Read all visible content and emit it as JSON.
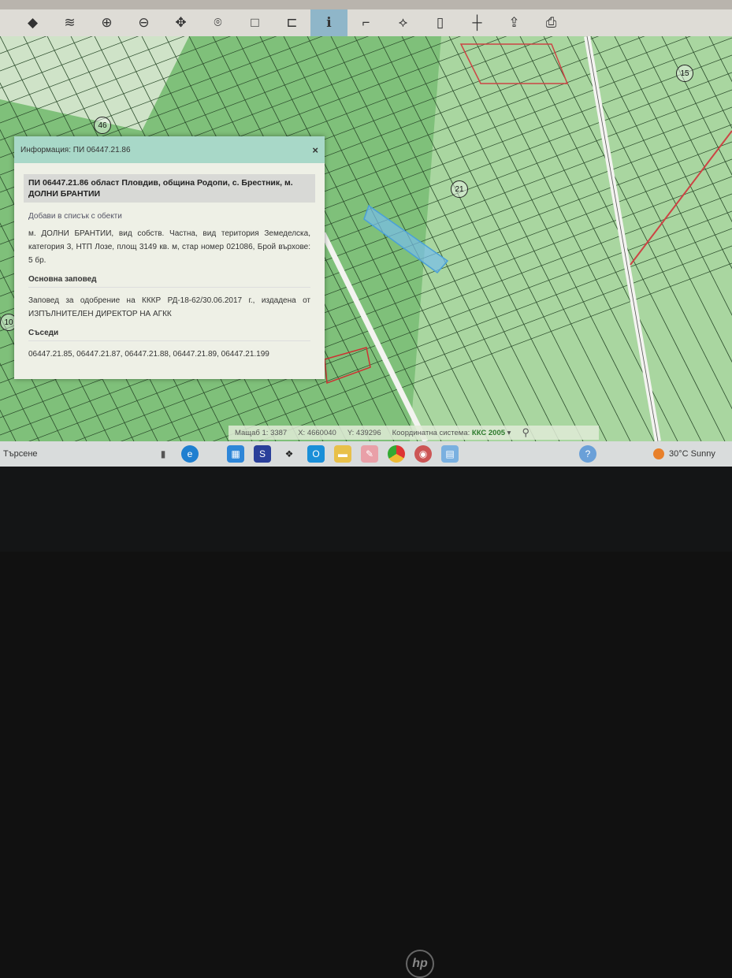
{
  "toolbar": {
    "icons": [
      "layers-icon",
      "layers-stack-icon",
      "zoom-in-icon",
      "zoom-out-icon",
      "pan-icon",
      "location-pin-icon",
      "select-rect-icon",
      "select-area-icon",
      "info-icon",
      "measure-icon",
      "polygon-icon",
      "map-icon",
      "crosshair-icon",
      "export-icon",
      "print-icon"
    ],
    "active": "info-icon"
  },
  "map": {
    "labels": [
      "46",
      "15",
      "21",
      "10"
    ]
  },
  "popup": {
    "header": "Информация: ПИ 06447.21.86",
    "close": "×",
    "title": "ПИ 06447.21.86 област Пловдив, община Родопи, с. Брестник, м. ДОЛНИ БРАНТИИ",
    "add_link": "Добави в списък с обекти",
    "description": "м. ДОЛНИ БРАНТИИ, вид собств. Частна, вид територия Земеделска, категория 3, НТП Лозе, площ 3149 кв. м, стар номер 021086, Брой върхове: 5 бр.",
    "order_heading": "Основна заповед",
    "order_text": "Заповед за одобрение на КККР РД-18-62/30.06.2017 г., издадена от ИЗПЪЛНИТЕЛЕН ДИРЕКТОР НА АГКК",
    "neighbors_heading": "Съседи",
    "neighbors": "06447.21.85, 06447.21.87, 06447.21.88, 06447.21.89, 06447.21.199"
  },
  "status": {
    "scale_label": "Мащаб 1:",
    "scale": "3387",
    "x_label": "X:",
    "x": "4660040",
    "y_label": "Y:",
    "y": "439296",
    "crs_label": "Координатна система:",
    "crs": "ККС 2005",
    "dropdown": "▾"
  },
  "taskbar": {
    "search": "Търсене",
    "weather": "30°C Sunny"
  },
  "brand": "hp"
}
